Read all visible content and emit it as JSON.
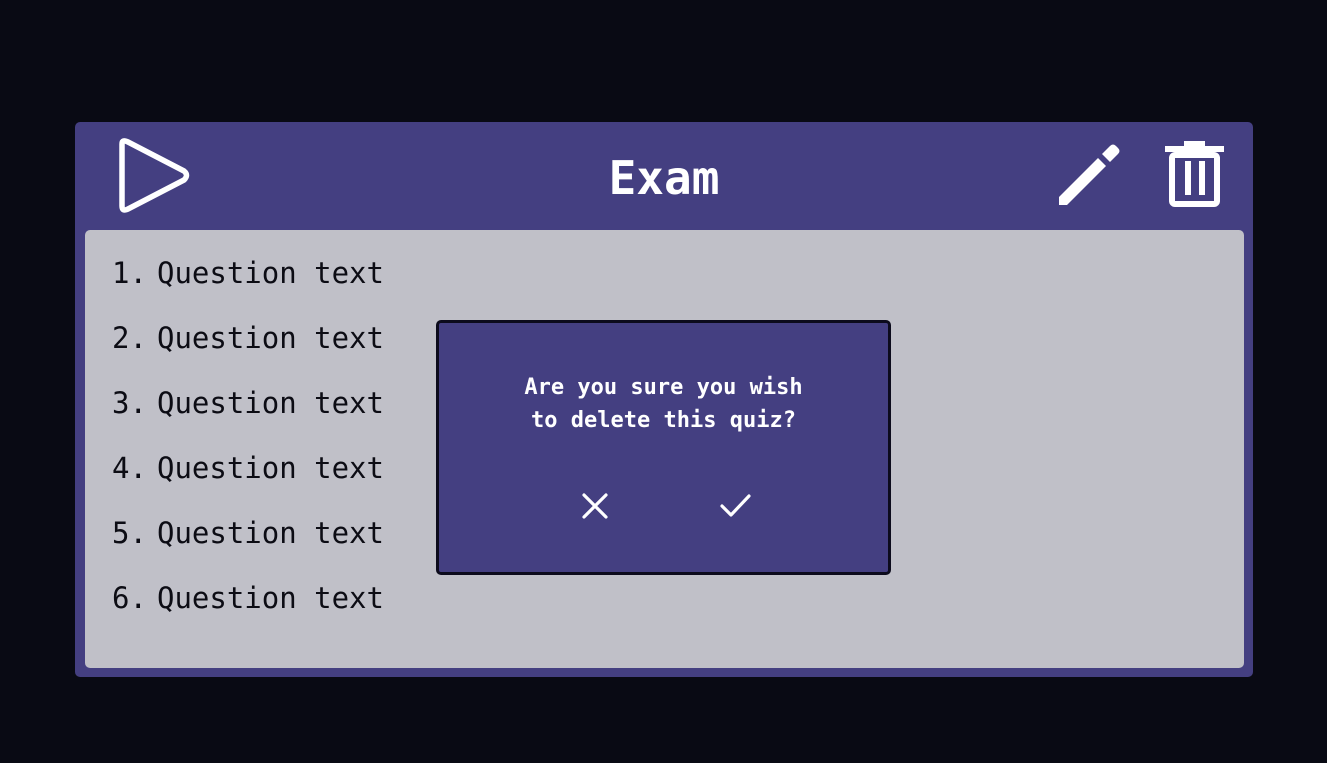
{
  "quiz": {
    "title": "Exam",
    "questions": [
      {
        "number": "1.",
        "text": "Question text"
      },
      {
        "number": "2.",
        "text": "Question text"
      },
      {
        "number": "3.",
        "text": "Question text"
      },
      {
        "number": "4.",
        "text": "Question text"
      },
      {
        "number": "5.",
        "text": "Question text"
      },
      {
        "number": "6.",
        "text": "Question text"
      }
    ]
  },
  "header": {
    "icons": [
      "play-icon",
      "pencil-icon",
      "trash-icon"
    ]
  },
  "dialog": {
    "message": "Are you sure you wish\nto delete this quiz?",
    "icons": [
      "close-icon",
      "check-icon"
    ]
  },
  "colors": {
    "background": "#090a14",
    "card": "#443f81",
    "panel": "#c0c0c8",
    "text_light": "#ffffff",
    "text_dark": "#0c0c14"
  }
}
